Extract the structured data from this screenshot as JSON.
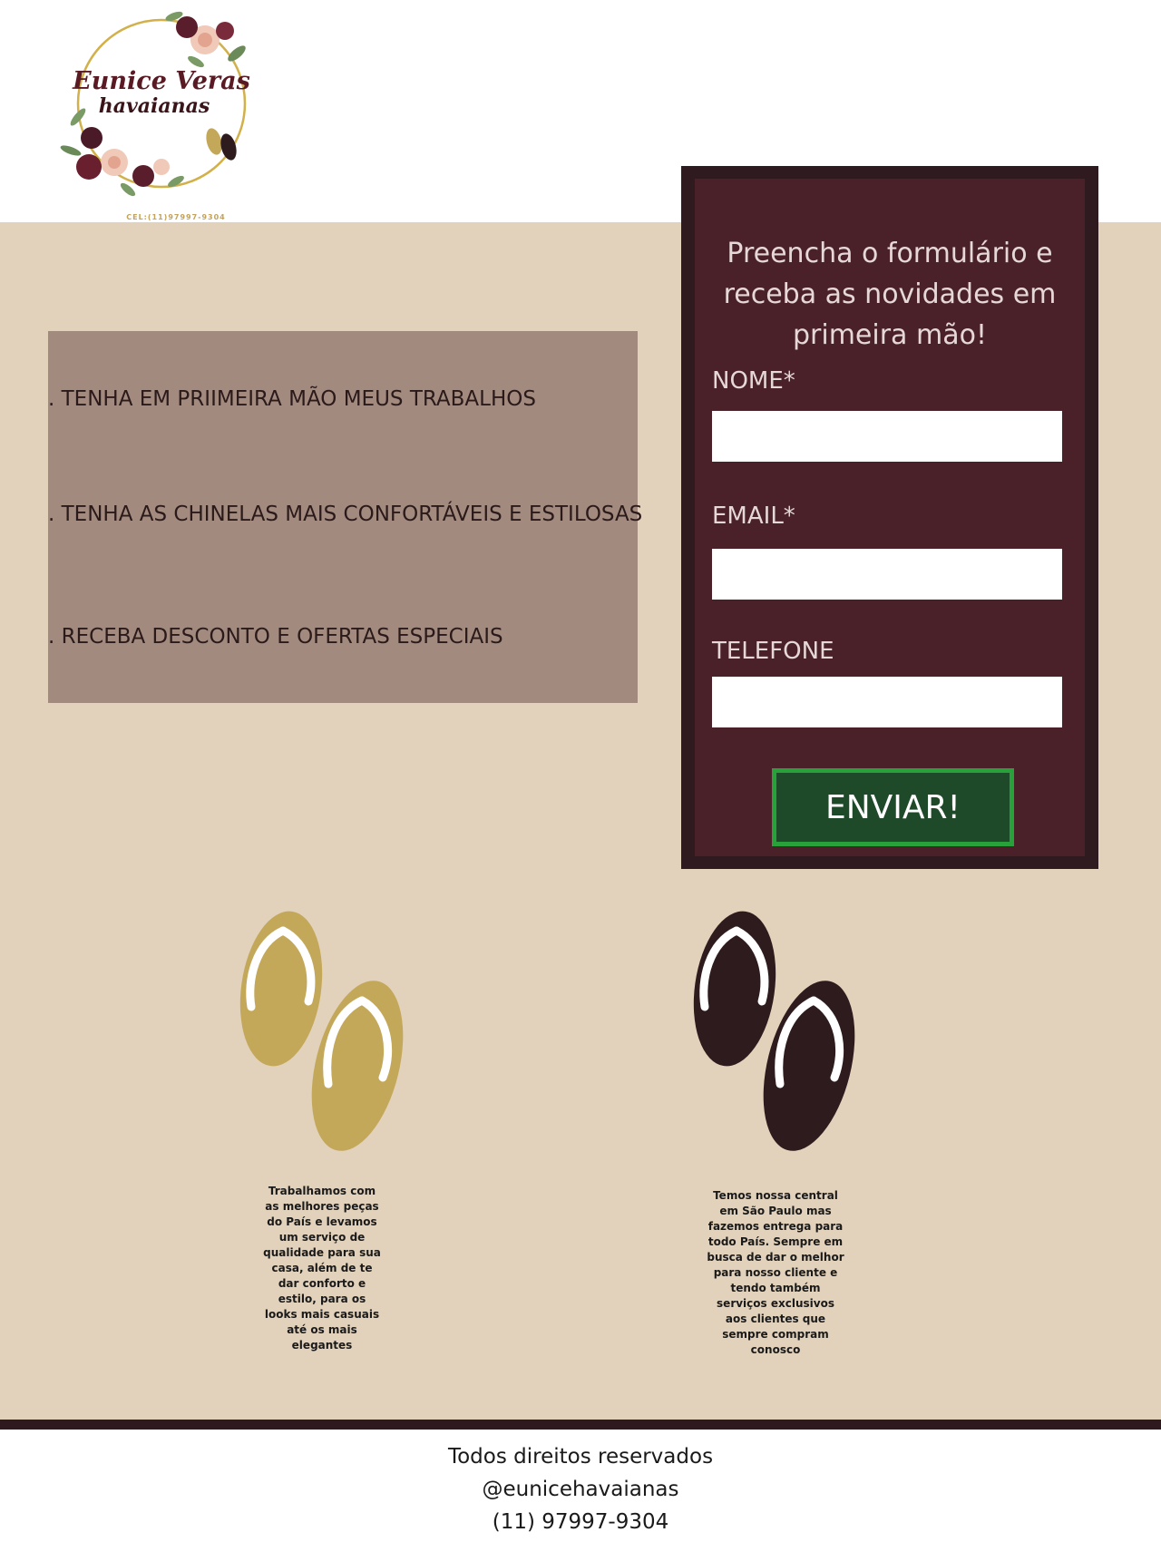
{
  "logo": {
    "name_line1": "Eunice Veras",
    "name_line2": "havaianas",
    "phone": "CEL:(11)97997-9304"
  },
  "benefits": [
    ". TENHA EM PRIIMEIRA MÃO MEUS TRABALHOS",
    ". TENHA AS CHINELAS MAIS CONFORTÁVEIS E ESTILOSAS",
    ". RECEBA DESCONTO E OFERTAS ESPECIAIS"
  ],
  "form": {
    "title": "Preencha o formulário e receba as novidades em primeira mão!",
    "name_label": "NOME*",
    "email_label": "EMAIL*",
    "phone_label": "TELEFONE",
    "name_value": "",
    "email_value": "",
    "phone_value": "",
    "submit_label": "ENVIAR!"
  },
  "features": [
    {
      "icon": "gold-flip-flops-icon",
      "color": "#c4a85a",
      "text": "Trabalhamos com\nas melhores peças\ndo País e levamos\num serviço de\nqualidade para sua\ncasa, além de te\ndar conforto e\nestilo, para os\nlooks mais casuais\naté os mais\nelegantes"
    },
    {
      "icon": "brown-flip-flops-icon",
      "color": "#2e1b1e",
      "text": "Temos nossa central\nem São Paulo mas\nfazemos entrega para\ntodo País. Sempre em\nbusca de dar o melhor\npara nosso cliente e\ntendo também\nserviços exclusivos\naos clientes que\nsempre compram\nconosco"
    }
  ],
  "footer": {
    "rights": "Todos direitos reservados",
    "instagram": "@eunicehavaianas",
    "phone": "(11) 97997-9304"
  },
  "colors": {
    "background": "#e3d2bb",
    "benefits_panel": "#a38a7f",
    "form_panel": "#4a2128",
    "button": "#1f4a2a",
    "button_border": "#28a13a"
  }
}
